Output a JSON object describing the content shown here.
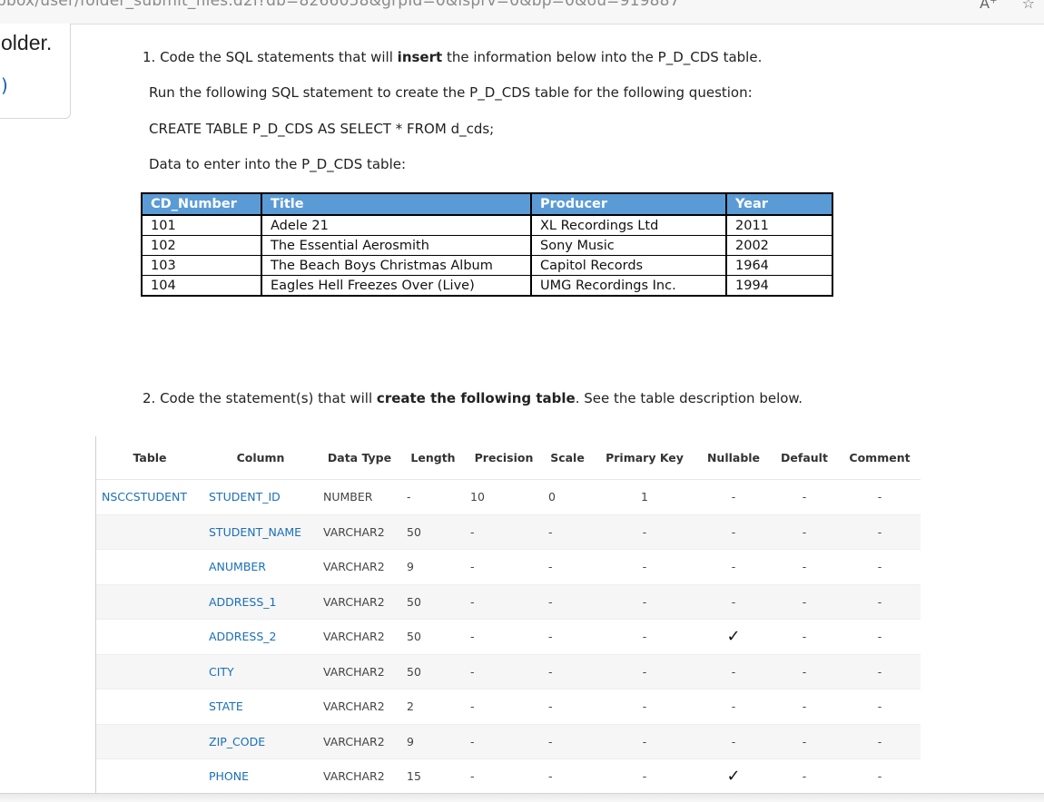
{
  "browser": {
    "url": "pbox/user/folder_submit_files.d2l?db=8266058&grpId=0&isprv=0&bp=0&ou=919887",
    "icons": [
      "text-size-icon",
      "favorite-icon"
    ],
    "text_size_glyph": "A⁺",
    "favorite_glyph": "☆"
  },
  "left_card": {
    "word": "older.",
    "link": ")"
  },
  "q1": {
    "prefix": "1. Code the SQL statements that will ",
    "bold": "insert",
    "suffix": " the information below into the P_D_CDS table.",
    "run_line": "Run the following SQL statement to create the P_D_CDS table for the following question:",
    "sql": "CREATE TABLE P_D_CDS AS SELECT * FROM d_cds;",
    "data_line": "Data to enter into the P_D_CDS table:"
  },
  "cds_table": {
    "headers": [
      "CD_Number",
      "Title",
      "Producer",
      "Year"
    ],
    "rows": [
      [
        "101",
        "Adele 21",
        "XL Recordings Ltd",
        "2011"
      ],
      [
        "102",
        "The Essential Aerosmith",
        "Sony Music",
        "2002"
      ],
      [
        "103",
        "The Beach Boys Christmas Album",
        "Capitol Records",
        "1964"
      ],
      [
        "104",
        "Eagles Hell Freezes Over (Live)",
        "UMG Recordings Inc.",
        "1994"
      ]
    ]
  },
  "q2": {
    "prefix": "2. Code the statement(s) that will ",
    "bold": "create the following table",
    "suffix": ". See the table description below."
  },
  "desc_table": {
    "headers": [
      "Table",
      "Column",
      "Data Type",
      "Length",
      "Precision",
      "Scale",
      "Primary Key",
      "Nullable",
      "Default",
      "Comment"
    ],
    "check_glyph": "✓",
    "rows": [
      [
        "NSCCSTUDENT",
        "STUDENT_ID",
        "NUMBER",
        "-",
        "10",
        "0",
        "1",
        "-",
        "-",
        "-"
      ],
      [
        "",
        "STUDENT_NAME",
        "VARCHAR2",
        "50",
        "-",
        "-",
        "-",
        "-",
        "-",
        "-"
      ],
      [
        "",
        "ANUMBER",
        "VARCHAR2",
        "9",
        "-",
        "-",
        "-",
        "-",
        "-",
        "-"
      ],
      [
        "",
        "ADDRESS_1",
        "VARCHAR2",
        "50",
        "-",
        "-",
        "-",
        "-",
        "-",
        "-"
      ],
      [
        "",
        "ADDRESS_2",
        "VARCHAR2",
        "50",
        "-",
        "-",
        "-",
        "✓",
        "-",
        "-"
      ],
      [
        "",
        "CITY",
        "VARCHAR2",
        "50",
        "-",
        "-",
        "-",
        "-",
        "-",
        "-"
      ],
      [
        "",
        "STATE",
        "VARCHAR2",
        "2",
        "-",
        "-",
        "-",
        "-",
        "-",
        "-"
      ],
      [
        "",
        "ZIP_CODE",
        "VARCHAR2",
        "9",
        "-",
        "-",
        "-",
        "-",
        "-",
        "-"
      ],
      [
        "",
        "PHONE",
        "VARCHAR2",
        "15",
        "-",
        "-",
        "-",
        "✓",
        "-",
        "-"
      ],
      [
        "",
        "",
        "",
        "",
        "",
        "",
        "",
        "",
        "",
        ""
      ]
    ]
  }
}
